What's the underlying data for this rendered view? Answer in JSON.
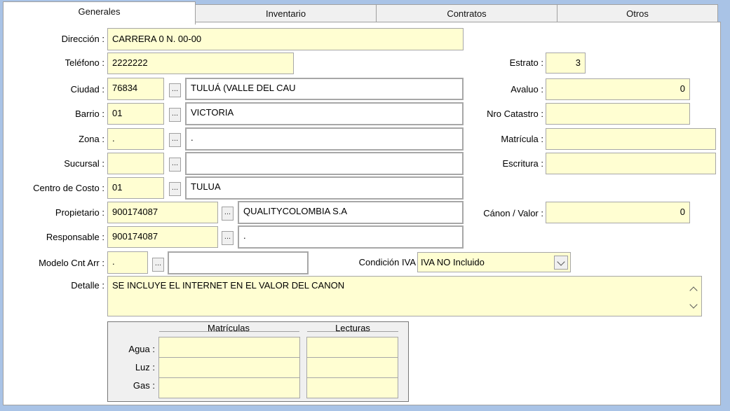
{
  "tabs": [
    "Generales",
    "Inventario",
    "Contratos",
    "Otros"
  ],
  "form": {
    "direccion_label": "Dirección :",
    "direccion": "CARRERA 0 N. 00-00",
    "telefono_label": "Teléfono :",
    "telefono": "2222222",
    "estrato_label": "Estrato :",
    "estrato": "3",
    "ciudad_label": "Ciudad :",
    "ciudad_code": "76834",
    "ciudad_name": "TULUÁ (VALLE DEL CAU",
    "avaluo_label": "Avaluo :",
    "avaluo": "0",
    "barrio_label": "Barrio :",
    "barrio_code": "01",
    "barrio_name": "VICTORIA",
    "nro_catastro_label": "Nro Catastro :",
    "nro_catastro": "",
    "zona_label": "Zona :",
    "zona_code": ".",
    "zona_name": ".",
    "matricula_label": "Matrícula :",
    "matricula": "",
    "sucursal_label": "Sucursal :",
    "sucursal_code": "",
    "sucursal_name": "",
    "escritura_label": "Escritura :",
    "escritura": "",
    "centro_costo_label": "Centro de Costo :",
    "centro_costo_code": "01",
    "centro_costo_name": "TULUA",
    "propietario_label": "Propietario :",
    "propietario_code": "900174087",
    "propietario_name": "QUALITYCOLOMBIA S.A",
    "canon_label": "Cánon / Valor :",
    "canon": "0",
    "responsable_label": "Responsable :",
    "responsable_code": "900174087",
    "responsable_name": ".",
    "modelo_label": "Modelo Cnt Arr :",
    "modelo_code": ".",
    "modelo_name": "",
    "condicion_iva_label": "Condición IVA",
    "condicion_iva": "IVA NO Incluido",
    "detalle_label": "Detalle :",
    "detalle": "SE INCLUYE EL INTERNET EN EL VALOR DEL CANON",
    "dots": "..."
  },
  "servicios": {
    "matriculas_header": "Matrículas",
    "lecturas_header": "Lecturas",
    "rows": [
      {
        "label": "Agua :",
        "matricula": "",
        "lectura": ""
      },
      {
        "label": "Luz :",
        "matricula": "",
        "lectura": ""
      },
      {
        "label": "Gas :",
        "matricula": "",
        "lectura": ""
      }
    ]
  }
}
